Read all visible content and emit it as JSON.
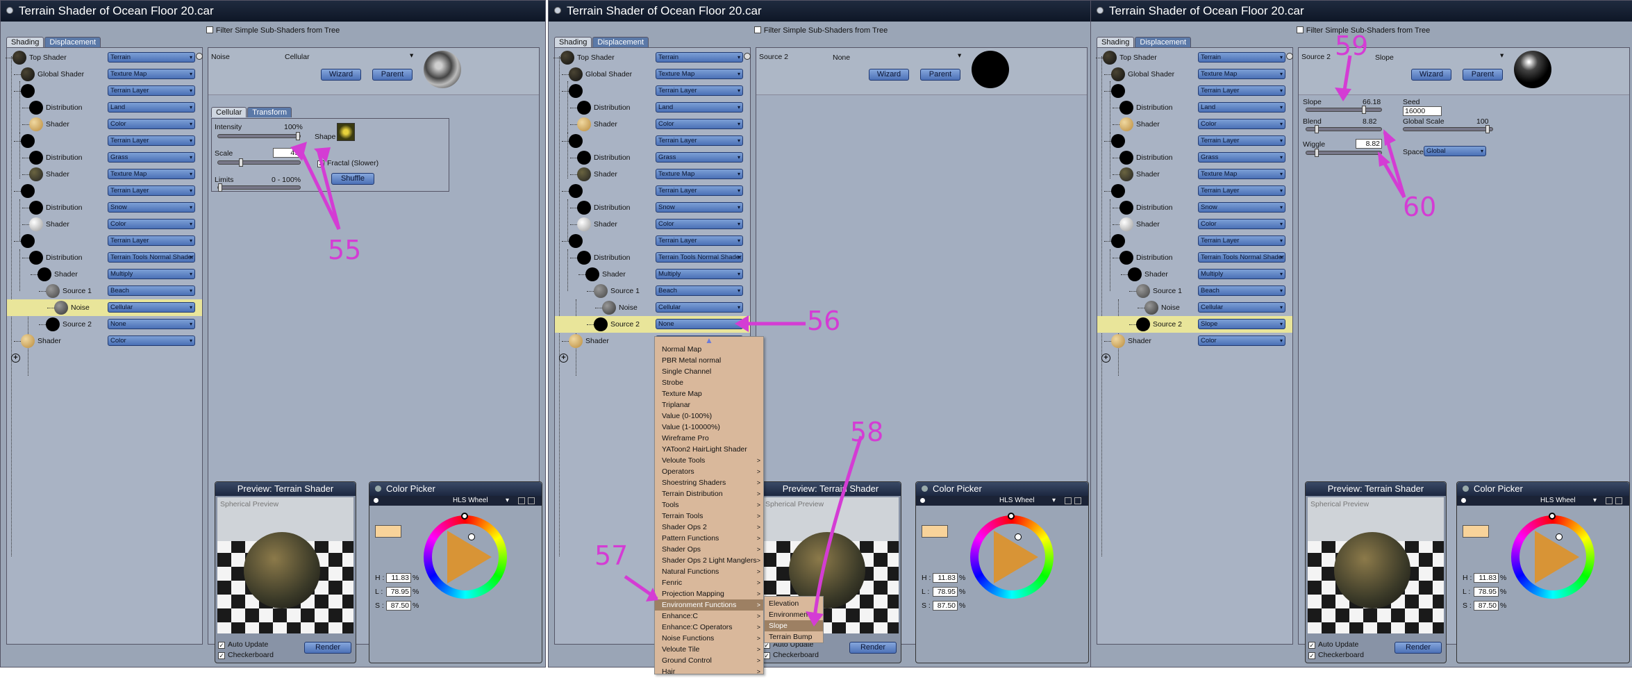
{
  "panels": [
    {
      "title": "Terrain Shader of Ocean Floor 20.car",
      "filter_label": "Filter Simple Sub-Shaders from Tree",
      "tabs": [
        "Shading",
        "Displacement"
      ],
      "tree": [
        {
          "label": "Top Shader",
          "value": "Terrain"
        },
        {
          "label": "Global Shader",
          "value": "Texture Map"
        },
        {
          "label": "",
          "value": "Terrain Layer"
        },
        {
          "label": "Distribution",
          "value": "Land"
        },
        {
          "label": "Shader",
          "value": "Color"
        },
        {
          "label": "",
          "value": "Terrain Layer"
        },
        {
          "label": "Distribution",
          "value": "Grass"
        },
        {
          "label": "Shader",
          "value": "Texture Map"
        },
        {
          "label": "",
          "value": "Terrain Layer"
        },
        {
          "label": "Distribution",
          "value": "Snow"
        },
        {
          "label": "Shader",
          "value": "Color"
        },
        {
          "label": "",
          "value": "Terrain Layer"
        },
        {
          "label": "Distribution",
          "value": "Terrain Tools Normal Shader"
        },
        {
          "label": "Shader",
          "value": "Multiply"
        },
        {
          "label": "Source 1",
          "value": "Beach"
        },
        {
          "label": "Noise",
          "value": "Cellular"
        },
        {
          "label": "Source 2",
          "value": "None"
        },
        {
          "label": "Shader",
          "value": "Color"
        }
      ],
      "selected_index": 15,
      "header_name": "Noise",
      "header_value": "Cellular",
      "wizard_label": "Wizard",
      "parent_label": "Parent",
      "subtabs": [
        "Cellular",
        "Transform"
      ],
      "params": {
        "intensity_label": "Intensity",
        "intensity_value": "100%",
        "shape_label": "Shape",
        "scale_label": "Scale",
        "scale_value": "49",
        "fractal_label": "Fractal (Slower)",
        "limits_label": "Limits",
        "limits_value": "0 - 100%",
        "shuffle_label": "Shuffle"
      }
    },
    {
      "title": "Terrain Shader of Ocean Floor 20.car",
      "filter_label": "Filter Simple Sub-Shaders from Tree",
      "tabs": [
        "Shading",
        "Displacement"
      ],
      "tree": [
        {
          "label": "Top Shader",
          "value": "Terrain"
        },
        {
          "label": "Global Shader",
          "value": "Texture Map"
        },
        {
          "label": "",
          "value": "Terrain Layer"
        },
        {
          "label": "Distribution",
          "value": "Land"
        },
        {
          "label": "Shader",
          "value": "Color"
        },
        {
          "label": "",
          "value": "Terrain Layer"
        },
        {
          "label": "Distribution",
          "value": "Grass"
        },
        {
          "label": "Shader",
          "value": "Texture Map"
        },
        {
          "label": "",
          "value": "Terrain Layer"
        },
        {
          "label": "Distribution",
          "value": "Snow"
        },
        {
          "label": "Shader",
          "value": "Color"
        },
        {
          "label": "",
          "value": "Terrain Layer"
        },
        {
          "label": "Distribution",
          "value": "Terrain Tools Normal Shader"
        },
        {
          "label": "Shader",
          "value": "Multiply"
        },
        {
          "label": "Source 1",
          "value": "Beach"
        },
        {
          "label": "Noise",
          "value": "Cellular"
        },
        {
          "label": "Source 2",
          "value": "None"
        },
        {
          "label": "Shader",
          "value": "Color"
        }
      ],
      "selected_index": 16,
      "header_name": "Source 2",
      "header_value": "None",
      "wizard_label": "Wizard",
      "parent_label": "Parent"
    },
    {
      "title": "Terrain Shader of Ocean Floor 20.car",
      "filter_label": "Filter Simple Sub-Shaders from Tree",
      "tabs": [
        "Shading",
        "Displacement"
      ],
      "tree": [
        {
          "label": "Top Shader",
          "value": "Terrain"
        },
        {
          "label": "Global Shader",
          "value": "Texture Map"
        },
        {
          "label": "",
          "value": "Terrain Layer"
        },
        {
          "label": "Distribution",
          "value": "Land"
        },
        {
          "label": "Shader",
          "value": "Color"
        },
        {
          "label": "",
          "value": "Terrain Layer"
        },
        {
          "label": "Distribution",
          "value": "Grass"
        },
        {
          "label": "Shader",
          "value": "Texture Map"
        },
        {
          "label": "",
          "value": "Terrain Layer"
        },
        {
          "label": "Distribution",
          "value": "Snow"
        },
        {
          "label": "Shader",
          "value": "Color"
        },
        {
          "label": "",
          "value": "Terrain Layer"
        },
        {
          "label": "Distribution",
          "value": "Terrain Tools Normal Shader"
        },
        {
          "label": "Shader",
          "value": "Multiply"
        },
        {
          "label": "Source 1",
          "value": "Beach"
        },
        {
          "label": "Noise",
          "value": "Cellular"
        },
        {
          "label": "Source 2",
          "value": "Slope"
        },
        {
          "label": "Shader",
          "value": "Color"
        }
      ],
      "selected_index": 16,
      "header_name": "Source 2",
      "header_value": "Slope",
      "wizard_label": "Wizard",
      "parent_label": "Parent",
      "params": {
        "slope_label": "Slope",
        "slope_value": "66.18",
        "seed_label": "Seed",
        "seed_value": "16000",
        "blend_label": "Blend",
        "blend_value": "8.82",
        "global_scale_label": "Global Scale",
        "global_scale_value": "100",
        "wiggle_label": "Wiggle",
        "wiggle_value": "8.82",
        "space_label": "Space",
        "space_value": "Global"
      }
    }
  ],
  "preview": {
    "title": "Preview: Terrain Shader",
    "overlay_text": "Spherical Preview",
    "auto_update_label": "Auto Update",
    "checkerboard_label": "Checkerboard",
    "render_label": "Render"
  },
  "color_picker": {
    "title": "Color Picker",
    "mode": "HLS Wheel",
    "h_label": "H :",
    "h_value": "11.83",
    "l_label": "L :",
    "l_value": "78.95",
    "s_label": "S :",
    "s_value": "87.50",
    "unit": "%",
    "swatch_color": "#f8d39a"
  },
  "menu": {
    "items": [
      {
        "label": "Normal Map",
        "sub": false
      },
      {
        "label": "PBR Metal normal",
        "sub": false
      },
      {
        "label": "Single Channel",
        "sub": false
      },
      {
        "label": "Strobe",
        "sub": false
      },
      {
        "label": "Texture Map",
        "sub": false
      },
      {
        "label": "Triplanar",
        "sub": false
      },
      {
        "label": "Value (0-100%)",
        "sub": false
      },
      {
        "label": "Value (1-10000%)",
        "sub": false
      },
      {
        "label": "Wireframe Pro",
        "sub": false
      },
      {
        "label": "YAToon2 HairLight Shader",
        "sub": false
      },
      {
        "label": "Veloute Tools",
        "sub": true
      },
      {
        "label": "Operators",
        "sub": true
      },
      {
        "label": "Shoestring Shaders",
        "sub": true
      },
      {
        "label": "Terrain Distribution",
        "sub": true
      },
      {
        "label": "Tools",
        "sub": true
      },
      {
        "label": "Terrain Tools",
        "sub": true
      },
      {
        "label": "Shader Ops 2",
        "sub": true
      },
      {
        "label": "Pattern Functions",
        "sub": true
      },
      {
        "label": "Shader Ops",
        "sub": true
      },
      {
        "label": "Shader Ops 2 Light Manglers",
        "sub": true
      },
      {
        "label": "Natural Functions",
        "sub": true
      },
      {
        "label": "Fenric",
        "sub": true
      },
      {
        "label": "Projection Mapping",
        "sub": true
      },
      {
        "label": "Environment Functions",
        "sub": true
      },
      {
        "label": "Enhance:C",
        "sub": true
      },
      {
        "label": "Enhance:C Operators",
        "sub": true
      },
      {
        "label": "Noise Functions",
        "sub": true
      },
      {
        "label": "Veloute Tile",
        "sub": true
      },
      {
        "label": "Ground Control",
        "sub": true
      },
      {
        "label": "Hair",
        "sub": true
      }
    ],
    "highlight_index": 23,
    "submenu": [
      "Elevation",
      "Environment",
      "Slope",
      "Terrain Bump"
    ],
    "submenu_highlight": 2
  },
  "annotations": [
    "55",
    "56",
    "57",
    "58",
    "59",
    "60"
  ],
  "colors": {
    "annotation": "#d43cd4",
    "selected_row": "#e9e59a",
    "dropdown": "#5a80c4"
  }
}
